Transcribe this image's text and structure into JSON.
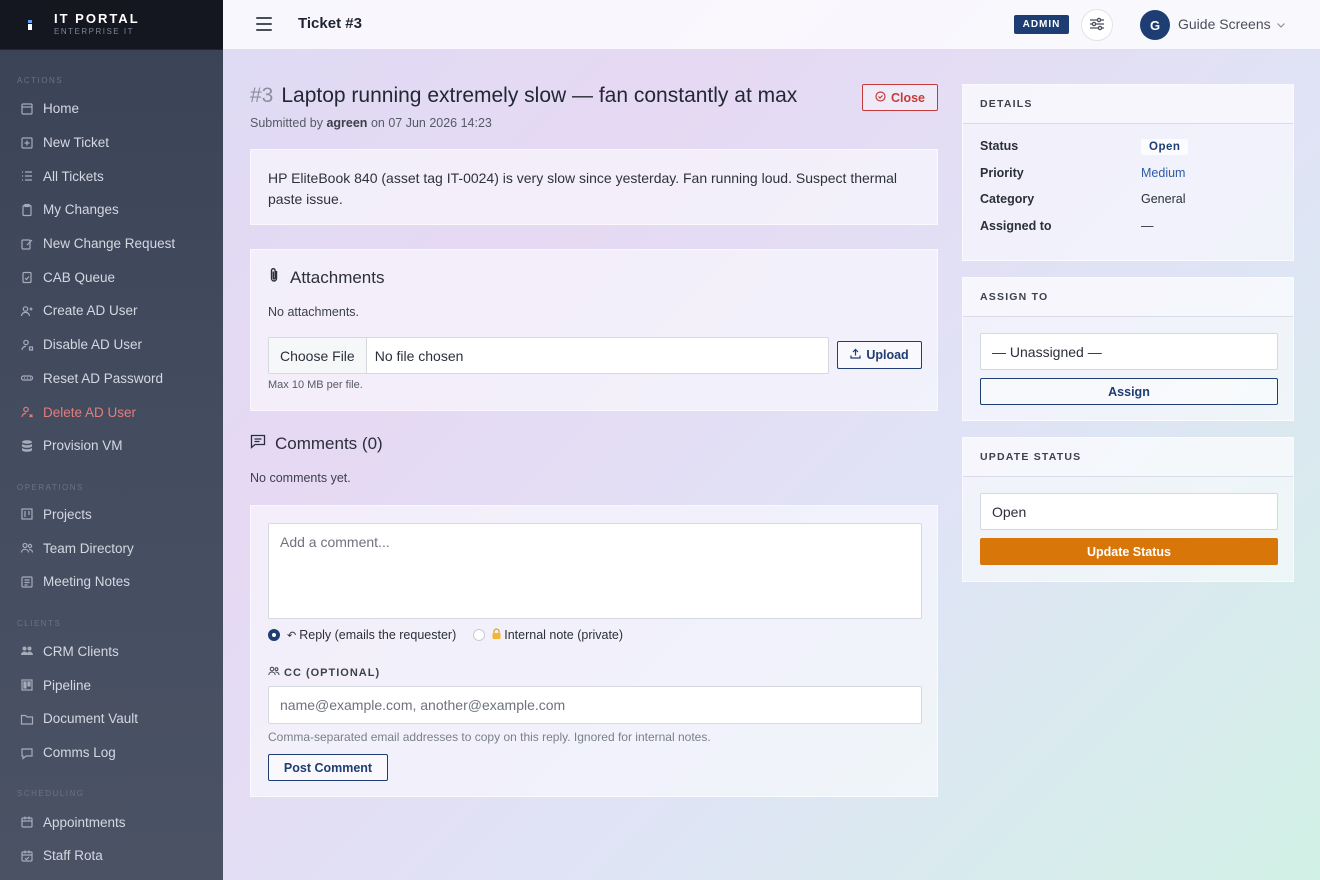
{
  "brand": {
    "title": "IT PORTAL",
    "subtitle": "ENTERPRISE IT"
  },
  "sidebar": {
    "sections": [
      {
        "label": "ACTIONS",
        "items": [
          {
            "label": "Home",
            "icon": "home-icon"
          },
          {
            "label": "New Ticket",
            "icon": "plus-square-icon"
          },
          {
            "label": "All Tickets",
            "icon": "list-icon"
          },
          {
            "label": "My Changes",
            "icon": "clipboard-icon"
          },
          {
            "label": "New Change Request",
            "icon": "edit-icon"
          },
          {
            "label": "CAB Queue",
            "icon": "clipboard-check-icon"
          },
          {
            "label": "Create AD User",
            "icon": "user-plus-icon"
          },
          {
            "label": "Disable AD User",
            "icon": "user-lock-icon"
          },
          {
            "label": "Reset AD Password",
            "icon": "key-icon"
          },
          {
            "label": "Delete AD User",
            "icon": "user-delete-icon"
          },
          {
            "label": "Provision VM",
            "icon": "database-icon"
          }
        ]
      },
      {
        "label": "OPERATIONS",
        "items": [
          {
            "label": "Projects",
            "icon": "kanban-icon"
          },
          {
            "label": "Team Directory",
            "icon": "users-icon"
          },
          {
            "label": "Meeting Notes",
            "icon": "notes-icon"
          }
        ]
      },
      {
        "label": "CLIENTS",
        "items": [
          {
            "label": "CRM Clients",
            "icon": "people-icon"
          },
          {
            "label": "Pipeline",
            "icon": "pipeline-icon"
          },
          {
            "label": "Document Vault",
            "icon": "folder-icon"
          },
          {
            "label": "Comms Log",
            "icon": "chat-icon"
          }
        ]
      },
      {
        "label": "SCHEDULING",
        "items": [
          {
            "label": "Appointments",
            "icon": "calendar-icon"
          },
          {
            "label": "Staff Rota",
            "icon": "calendar-check-icon"
          }
        ]
      }
    ]
  },
  "topbar": {
    "title": "Ticket #3",
    "role_badge": "ADMIN",
    "avatar_initial": "G",
    "user_name": "Guide Screens"
  },
  "ticket": {
    "number": "#3",
    "title": "Laptop running extremely slow — fan constantly at max",
    "close_label": "Close",
    "submitted_prefix": "Submitted by",
    "submitted_user": "agreen",
    "submitted_suffix": "on 07 Jun 2026 14:23",
    "description": "HP EliteBook 840 (asset tag IT-0024) is very slow since yesterday. Fan running loud. Suspect thermal paste issue."
  },
  "attachments": {
    "title": "Attachments",
    "empty_text": "No attachments.",
    "choose_label": "Choose File",
    "no_file_text": "No file chosen",
    "upload_label": "Upload",
    "hint": "Max 10 MB per file."
  },
  "comments": {
    "title": "Comments (0)",
    "empty_text": "No comments yet.",
    "placeholder": "Add a comment...",
    "reply_label": "Reply (emails the requester)",
    "internal_label": "Internal note (private)",
    "cc_label": "CC (OPTIONAL)",
    "cc_placeholder": "name@example.com, another@example.com",
    "cc_hint": "Comma-separated email addresses to copy on this reply. Ignored for internal notes.",
    "post_label": "Post Comment"
  },
  "details": {
    "title": "DETAILS",
    "rows": [
      {
        "key": "Status",
        "value": "Open"
      },
      {
        "key": "Priority",
        "value": "Medium"
      },
      {
        "key": "Category",
        "value": "General"
      },
      {
        "key": "Assigned to",
        "value": "—"
      }
    ]
  },
  "assign": {
    "title": "ASSIGN TO",
    "selected": "— Unassigned —",
    "button_label": "Assign"
  },
  "update_status": {
    "title": "UPDATE STATUS",
    "selected": "Open",
    "button_label": "Update Status"
  },
  "colors": {
    "accent": "#1e3d72",
    "danger": "#c53b3b",
    "warning": "#d9760a"
  }
}
